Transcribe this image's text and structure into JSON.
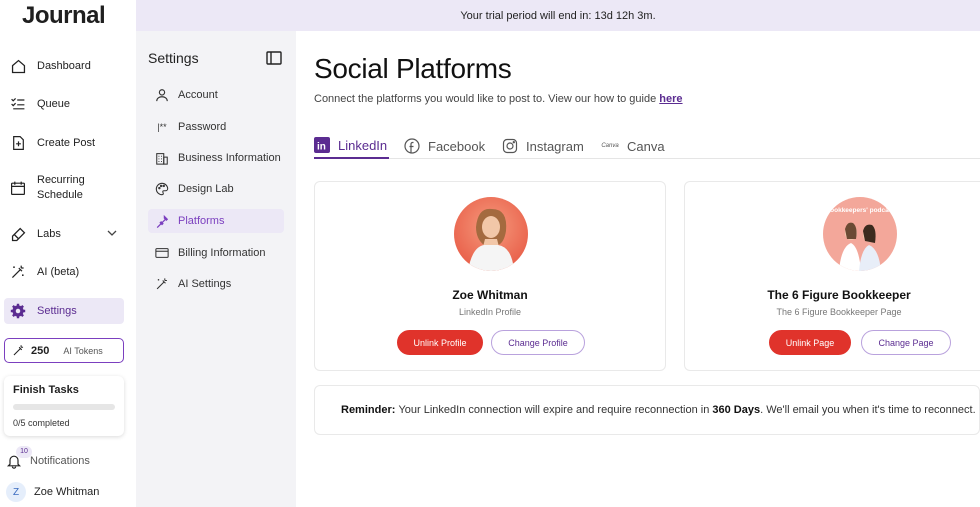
{
  "app": {
    "logo": "Journal"
  },
  "banner": {
    "text": "Your trial period will end in: 13d 12h 3m."
  },
  "sidebar": {
    "items": [
      {
        "label": "Dashboard",
        "icon": "home-icon"
      },
      {
        "label": "Queue",
        "icon": "list-icon"
      },
      {
        "label": "Create Post",
        "icon": "create-post-icon"
      },
      {
        "label": "Recurring Schedule",
        "icon": "calendar-icon"
      },
      {
        "label": "Labs",
        "icon": "flask-icon"
      },
      {
        "label": "AI (beta)",
        "icon": "magic-wand-icon"
      },
      {
        "label": "Settings",
        "icon": "gear-icon"
      }
    ],
    "tokens": {
      "count": "250",
      "label": "AI Tokens"
    },
    "tasks": {
      "title": "Finish Tasks",
      "completed": "0/5 completed",
      "progress": 0
    },
    "notifications": {
      "label": "Notifications",
      "count": "10"
    },
    "user": {
      "initial": "Z",
      "name": "Zoe Whitman"
    }
  },
  "settings": {
    "title": "Settings",
    "items": [
      {
        "label": "Account",
        "icon": "user-icon"
      },
      {
        "label": "Password",
        "icon": "password-icon"
      },
      {
        "label": "Business Information",
        "icon": "building-icon"
      },
      {
        "label": "Design Lab",
        "icon": "palette-icon"
      },
      {
        "label": "Platforms",
        "icon": "plug-icon"
      },
      {
        "label": "Billing Information",
        "icon": "card-icon"
      },
      {
        "label": "AI Settings",
        "icon": "magic-wand-icon"
      }
    ]
  },
  "main": {
    "title": "Social Platforms",
    "subtitle": "Connect the platforms you would like to post to. View our how to guide",
    "guide_link": "here",
    "tabs": [
      {
        "label": "LinkedIn",
        "icon": "linkedin-icon"
      },
      {
        "label": "Facebook",
        "icon": "facebook-icon"
      },
      {
        "label": "Instagram",
        "icon": "instagram-icon"
      },
      {
        "label": "Canva",
        "icon": "canva-icon"
      }
    ],
    "cards": [
      {
        "name": "Zoe Whitman",
        "role": "LinkedIn Profile",
        "unlink": "Unlink Profile",
        "change": "Change Profile"
      },
      {
        "name": "The 6 Figure Bookkeeper",
        "role": "The 6 Figure Bookkeeper Page",
        "unlink": "Unlink Page",
        "change": "Change Page",
        "avatar_text": "Bookkeepers' podcast"
      }
    ],
    "reminder": {
      "label": "Reminder:",
      "text1": "Your LinkedIn connection will expire and require reconnection in",
      "days": "360 Days",
      "text2": ". We'll email you when it's time to reconnect."
    }
  },
  "colors": {
    "accent": "#5b2c91",
    "accent_light": "#ece8f6",
    "danger": "#e0332b"
  }
}
